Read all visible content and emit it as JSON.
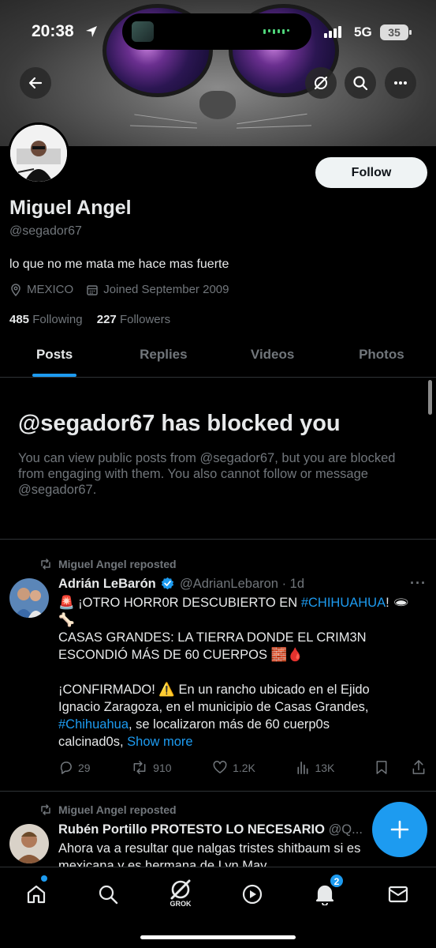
{
  "status_bar": {
    "time": "20:38",
    "network": "5G",
    "battery": "35"
  },
  "profile": {
    "name": "Miguel Angel",
    "handle": "@segador67",
    "bio": "lo que no me mata me hace mas fuerte",
    "location": "MEXICO",
    "joined": "Joined September 2009",
    "following_count": "485",
    "following_label": "Following",
    "followers_count": "227",
    "followers_label": "Followers",
    "follow_label": "Follow"
  },
  "tabs": [
    {
      "label": "Posts",
      "active": true
    },
    {
      "label": "Replies",
      "active": false
    },
    {
      "label": "Videos",
      "active": false
    },
    {
      "label": "Photos",
      "active": false
    }
  ],
  "blocked": {
    "title": "@segador67 has blocked you",
    "text": "You can view public posts from @segador67, but you are blocked from engaging with them. You also cannot follow or message @segador67."
  },
  "posts": [
    {
      "repost_label": "Miguel Angel reposted",
      "author": "Adrián LeBarón",
      "handle": "@AdrianLebaron",
      "time": "· 1d",
      "line1_a": "🚨 ¡OTRO HORR0R DESCUBIERTO EN ",
      "line1_tag": "#CHIHUAHUA",
      "line1_b": "! 🕳",
      "line2": "🦴",
      "line3": "CASAS GRANDES: LA TIERRA DONDE EL CRIM3N",
      "line4": "ESCONDIÓ MÁS DE 60 CUERPOS 🧱🩸",
      "line5": "¡CONFIRMADO! ⚠️ En un rancho ubicado en el Ejido",
      "line6": "Ignacio Zaragoza, en el municipio de Casas Grandes,",
      "line7_tag": "#Chihuahua",
      "line7_b": ", se localizaron más de 60 cuerp0s",
      "line8": "calcinad0s, ",
      "show_more": "Show more",
      "replies": "29",
      "reposts": "910",
      "likes": "1.2K",
      "views": "13K"
    },
    {
      "repost_label": "Miguel Angel reposted",
      "author": "Rubén Portillo PROTESTO LO NECESARIO",
      "handle": "@Q...",
      "line1": "Ahora va a resultar que nalgas tristes shitbaum si es",
      "line2": "mexicana y es hermana de Lyn May"
    }
  ],
  "bottom_nav": {
    "grok_label": "GROK",
    "notifications_badge": "2"
  },
  "icons": [
    "back-arrow-icon",
    "grok-icon",
    "search-icon",
    "more-icon",
    "location-icon",
    "calendar-icon",
    "repost-icon",
    "verified-icon",
    "reply-icon",
    "like-icon",
    "views-icon",
    "bookmark-icon",
    "share-icon",
    "plus-icon",
    "home-icon",
    "play-icon",
    "bell-icon",
    "mail-icon"
  ],
  "colors": {
    "accent": "#1d9bf0",
    "background": "#000000",
    "muted": "#71767b",
    "text": "#e7e9ea"
  }
}
